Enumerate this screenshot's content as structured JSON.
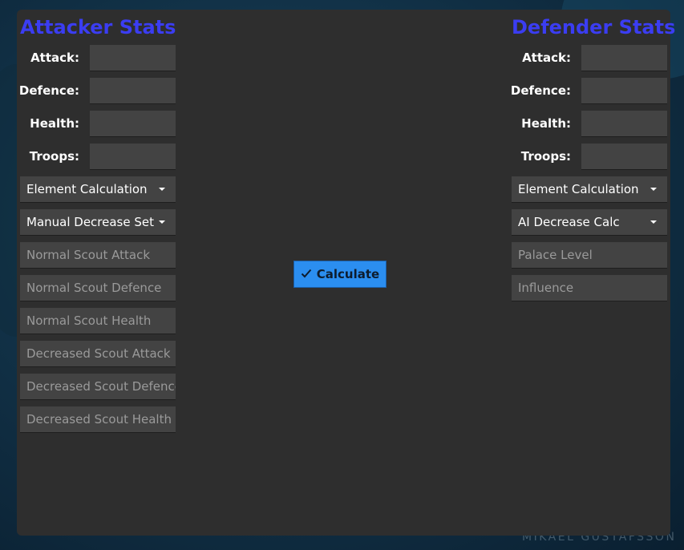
{
  "attacker": {
    "title": "Attacker Stats",
    "fields": [
      {
        "label": "Attack:",
        "value": ""
      },
      {
        "label": "Defence:",
        "value": ""
      },
      {
        "label": "Health:",
        "value": ""
      },
      {
        "label": "Troops:",
        "value": ""
      }
    ],
    "dropdowns": [
      {
        "selected": "Element Calculation"
      },
      {
        "selected": "Manual Decrease Set"
      }
    ],
    "inputs": [
      {
        "placeholder": "Normal Scout Attack"
      },
      {
        "placeholder": "Normal Scout Defence"
      },
      {
        "placeholder": "Normal Scout Health"
      },
      {
        "placeholder": "Decreased Scout Attack"
      },
      {
        "placeholder": "Decreased Scout Defence"
      },
      {
        "placeholder": "Decreased Scout Health"
      }
    ]
  },
  "defender": {
    "title": "Defender Stats",
    "fields": [
      {
        "label": "Attack:",
        "value": ""
      },
      {
        "label": "Defence:",
        "value": ""
      },
      {
        "label": "Health:",
        "value": ""
      },
      {
        "label": "Troops:",
        "value": ""
      }
    ],
    "dropdowns": [
      {
        "selected": "Element Calculation"
      },
      {
        "selected": "AI Decrease Calc"
      }
    ],
    "inputs": [
      {
        "placeholder": "Palace Level"
      },
      {
        "placeholder": "Influence"
      }
    ]
  },
  "calculate_button": {
    "label": "Calculate",
    "icon": "check-icon"
  },
  "watermark": "MIKAEL GUSTAFSSON",
  "colors": {
    "title": "#3b3df2",
    "panel": "#2e2e2e",
    "field": "#434343",
    "button": "#2b8ef0",
    "placeholder": "#9a9a9a"
  }
}
